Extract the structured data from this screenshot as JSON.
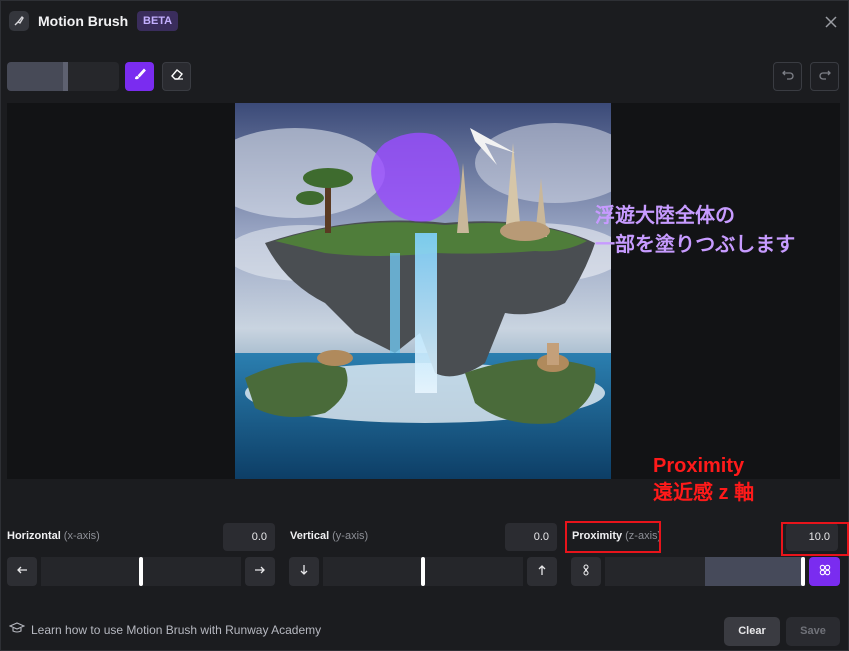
{
  "header": {
    "title": "Motion Brush",
    "badge": "BETA",
    "icon": "motion-brush-icon",
    "close_icon": "close-icon"
  },
  "toolbar": {
    "brush_size_fraction": 0.5,
    "brush_icon": "paintbrush-icon",
    "eraser_icon": "eraser-icon",
    "undo_icon": "undo-icon",
    "redo_icon": "redo-icon"
  },
  "canvas": {
    "annotation_jp": [
      "浮遊大陸全体の",
      "一部を塗りつぶします"
    ]
  },
  "annotation_red": {
    "line1": "Proximity",
    "line2": "遠近感 z 軸"
  },
  "controls": {
    "horizontal": {
      "label": "Horizontal",
      "sublabel": "(x-axis)",
      "value": "0.0",
      "position_fraction": 0.5,
      "left_icon": "arrow-left-icon",
      "right_icon": "arrow-right-icon"
    },
    "vertical": {
      "label": "Vertical",
      "sublabel": "(y-axis)",
      "value": "0.0",
      "position_fraction": 0.5,
      "left_icon": "arrow-down-icon",
      "right_icon": "arrow-up-icon"
    },
    "proximity": {
      "label": "Proximity",
      "sublabel": "(z-axis)",
      "value": "10.0",
      "position_fraction": 1.0,
      "left_icon": "proximity-far-icon",
      "right_icon": "proximity-near-icon"
    }
  },
  "footer": {
    "learn_link": "Learn how to use Motion Brush with Runway Academy",
    "learn_icon": "graduation-cap-icon",
    "clear_label": "Clear",
    "save_label": "Save"
  },
  "colors": {
    "accent": "#7a2cf0",
    "annotation_purple": "#c79bff",
    "annotation_red": "#ff1a1a",
    "background": "#1b1c1f"
  }
}
